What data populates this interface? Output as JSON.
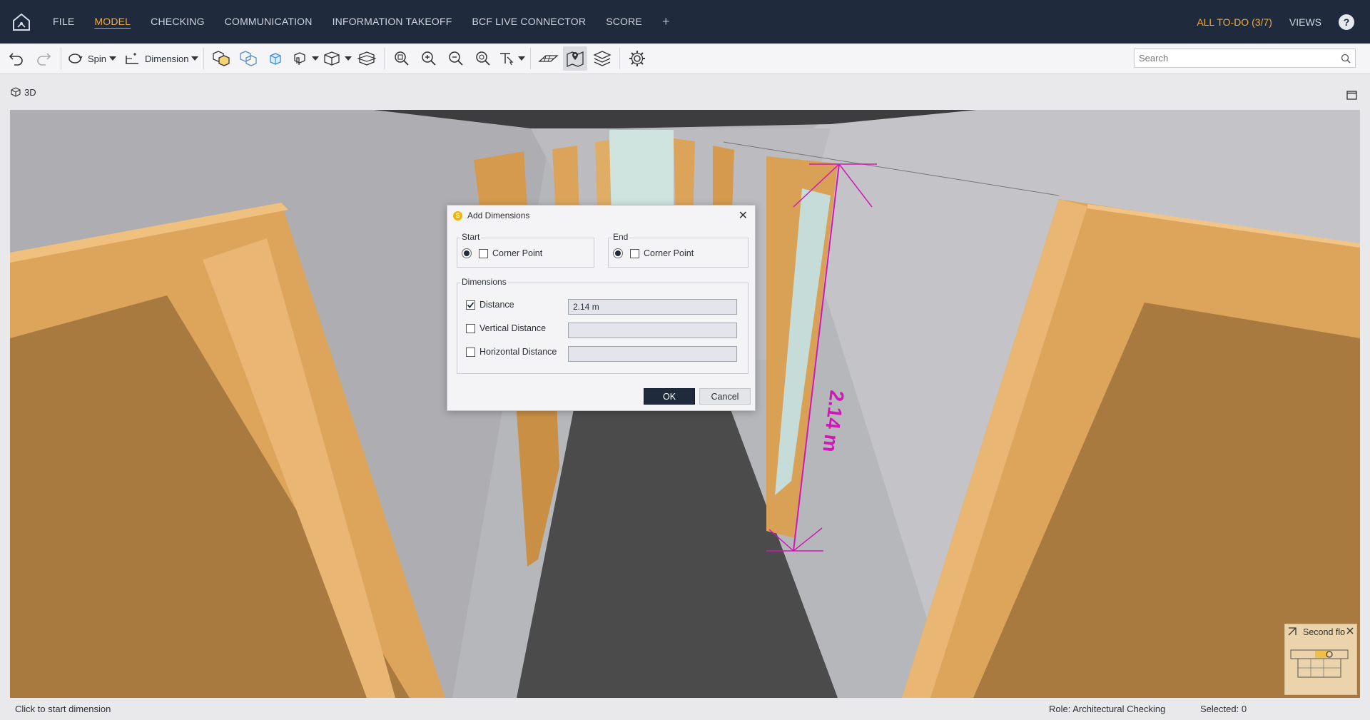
{
  "menu": {
    "items": [
      "FILE",
      "MODEL",
      "CHECKING",
      "COMMUNICATION",
      "INFORMATION TAKEOFF",
      "BCF LIVE CONNECTOR",
      "SCORE"
    ],
    "active": "MODEL",
    "plus": "+",
    "todo": "ALL TO-DO (3/7)",
    "views": "VIEWS",
    "help": "?"
  },
  "toolbar": {
    "spin_label": "Spin",
    "dimension_label": "Dimension",
    "search_placeholder": "Search"
  },
  "view": {
    "label": "3D"
  },
  "measurement": {
    "label": "2.14 m",
    "color": "#d018b8"
  },
  "dialog": {
    "title": "Add Dimensions",
    "start_label": "Start",
    "end_label": "End",
    "start_option": "Corner Point",
    "end_option": "Corner Point",
    "dimensions_label": "Dimensions",
    "distance_label": "Distance",
    "distance_value": "2.14 m",
    "distance_checked": true,
    "vertical_label": "Vertical Distance",
    "vertical_value": "",
    "horizontal_label": "Horizontal Distance",
    "horizontal_value": "",
    "ok_label": "OK",
    "cancel_label": "Cancel"
  },
  "minimap": {
    "title": "Second flo"
  },
  "status": {
    "hint": "Click to start dimension",
    "role": "Role: Architectural Checking",
    "selected": "Selected: 0"
  },
  "colors": {
    "topbar": "#1f2a3d",
    "accent": "#f2a93b",
    "door_wood": "#dba45a",
    "floor": "#4a4a4b",
    "wall": "#b5b6ba"
  }
}
